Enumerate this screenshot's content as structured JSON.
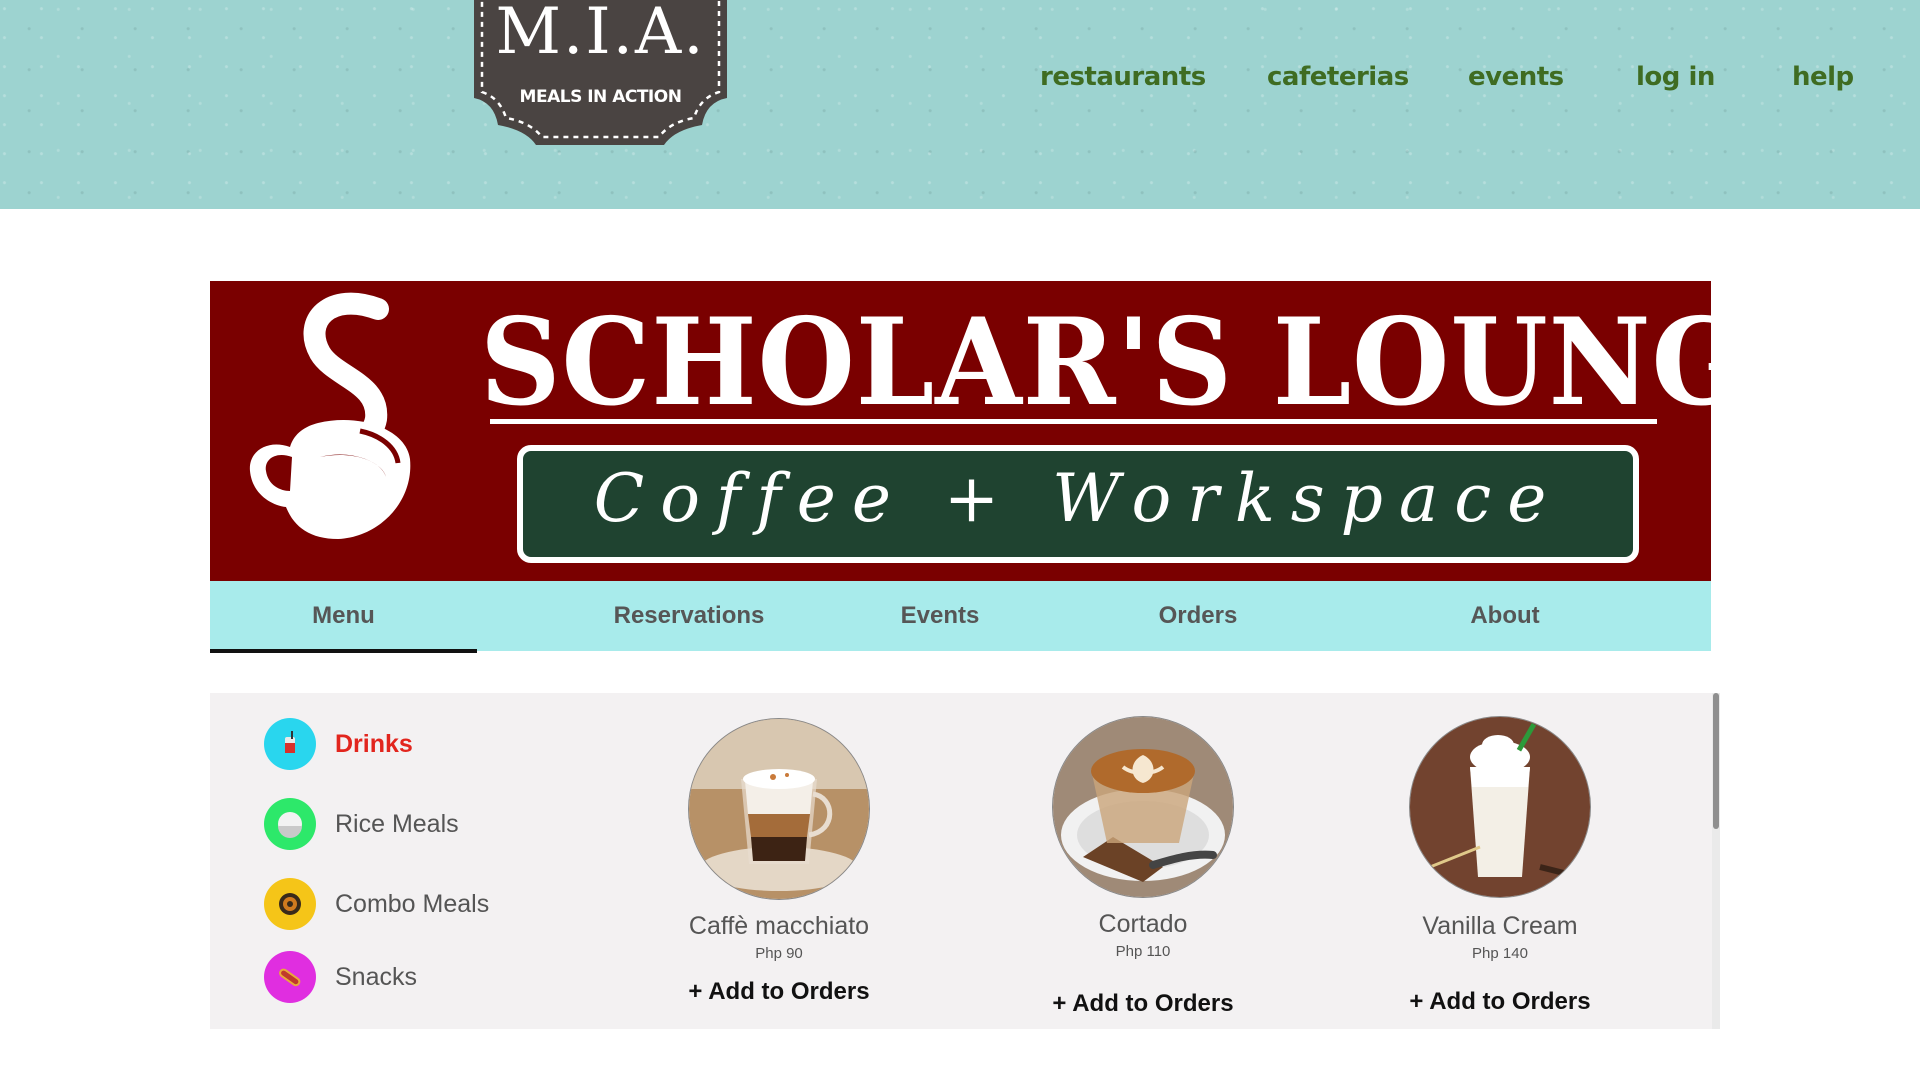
{
  "logo": {
    "title": "M.I.A.",
    "subtitle": "MEALS IN ACTION"
  },
  "top_nav": [
    {
      "label": "restaurants"
    },
    {
      "label": "cafeterias"
    },
    {
      "label": "events"
    },
    {
      "label": "log in"
    },
    {
      "label": "help"
    }
  ],
  "banner": {
    "title": "SCHOLAR'S LOUNGE",
    "tagline": "Coffee + Workspace",
    "icon": "coffee-cup-icon",
    "colors": {
      "background": "#7a0000",
      "tagline_box": "#1f4330"
    }
  },
  "tabs": [
    {
      "label": "Menu",
      "active": true
    },
    {
      "label": "Reservations",
      "active": false
    },
    {
      "label": "Events",
      "active": false
    },
    {
      "label": "Orders",
      "active": false
    },
    {
      "label": "About",
      "active": false
    }
  ],
  "categories": [
    {
      "label": "Drinks",
      "icon": "drink-cup-icon",
      "color": "#29d6ee",
      "active": true
    },
    {
      "label": "Rice Meals",
      "icon": "rice-bowl-icon",
      "color": "#2de86a",
      "active": false
    },
    {
      "label": "Combo Meals",
      "icon": "plate-icon",
      "color": "#f5c518",
      "active": false
    },
    {
      "label": "Snacks",
      "icon": "hotdog-icon",
      "color": "#e02ee0",
      "active": false
    }
  ],
  "products": [
    {
      "name": "Caffè macchiato",
      "price": "Php 90",
      "add_label": "+ Add to Orders"
    },
    {
      "name": "Cortado",
      "price": "Php 110",
      "add_label": "+ Add to Orders"
    },
    {
      "name": "Vanilla Cream",
      "price": "Php 140",
      "add_label": "+ Add to Orders"
    }
  ],
  "colors": {
    "header_bg": "#9dd3d0",
    "nav_text": "#3f6c22",
    "tab_bar": "#a8ebeb",
    "active_category": "#e2251d"
  }
}
